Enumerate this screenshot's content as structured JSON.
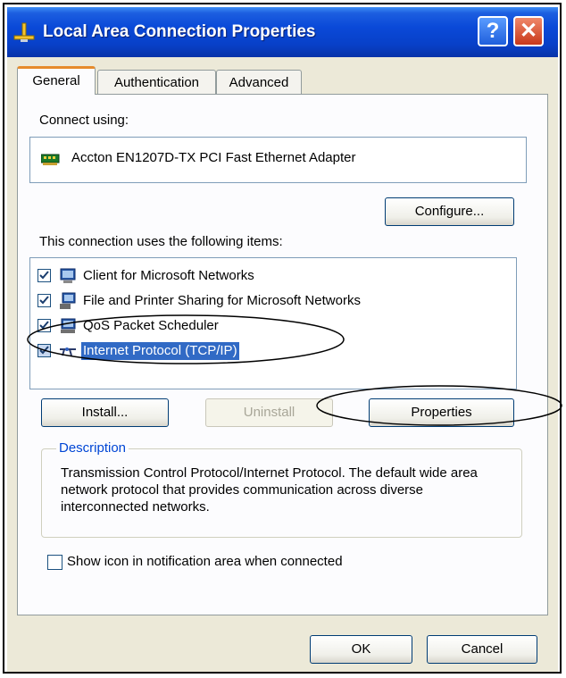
{
  "window": {
    "title": "Local Area Connection Properties",
    "help_label": "?",
    "close_label": "✕"
  },
  "tabs": [
    {
      "label": "General",
      "active": true
    },
    {
      "label": "Authentication",
      "active": false
    },
    {
      "label": "Advanced",
      "active": false
    }
  ],
  "general": {
    "connect_using_label": "Connect using:",
    "adapter_name": "Accton EN1207D-TX PCI Fast Ethernet Adapter",
    "configure_label": "Configure...",
    "items_label": "This connection uses the following items:",
    "items": [
      {
        "label": "Client for Microsoft Networks",
        "checked": true,
        "icon": "network-client-icon"
      },
      {
        "label": "File and Printer Sharing for Microsoft Networks",
        "checked": true,
        "icon": "file-sharing-icon"
      },
      {
        "label": "QoS Packet Scheduler",
        "checked": true,
        "icon": "qos-scheduler-icon"
      },
      {
        "label": "Internet Protocol (TCP/IP)",
        "checked": true,
        "icon": "network-protocol-icon",
        "selected": true
      }
    ],
    "install_label": "Install...",
    "uninstall_label": "Uninstall",
    "properties_label": "Properties",
    "description_title": "Description",
    "description_text": "Transmission Control Protocol/Internet Protocol. The default wide area network protocol that provides communication across diverse interconnected networks.",
    "show_icon_label": "Show icon in notification area when connected",
    "show_icon_checked": false
  },
  "footer": {
    "ok_label": "OK",
    "cancel_label": "Cancel"
  },
  "colors": {
    "titlebar": "#0a49d8",
    "selection": "#316ac5",
    "dialog_bg": "#ece9d8",
    "accent_tab": "#e68b2c"
  }
}
